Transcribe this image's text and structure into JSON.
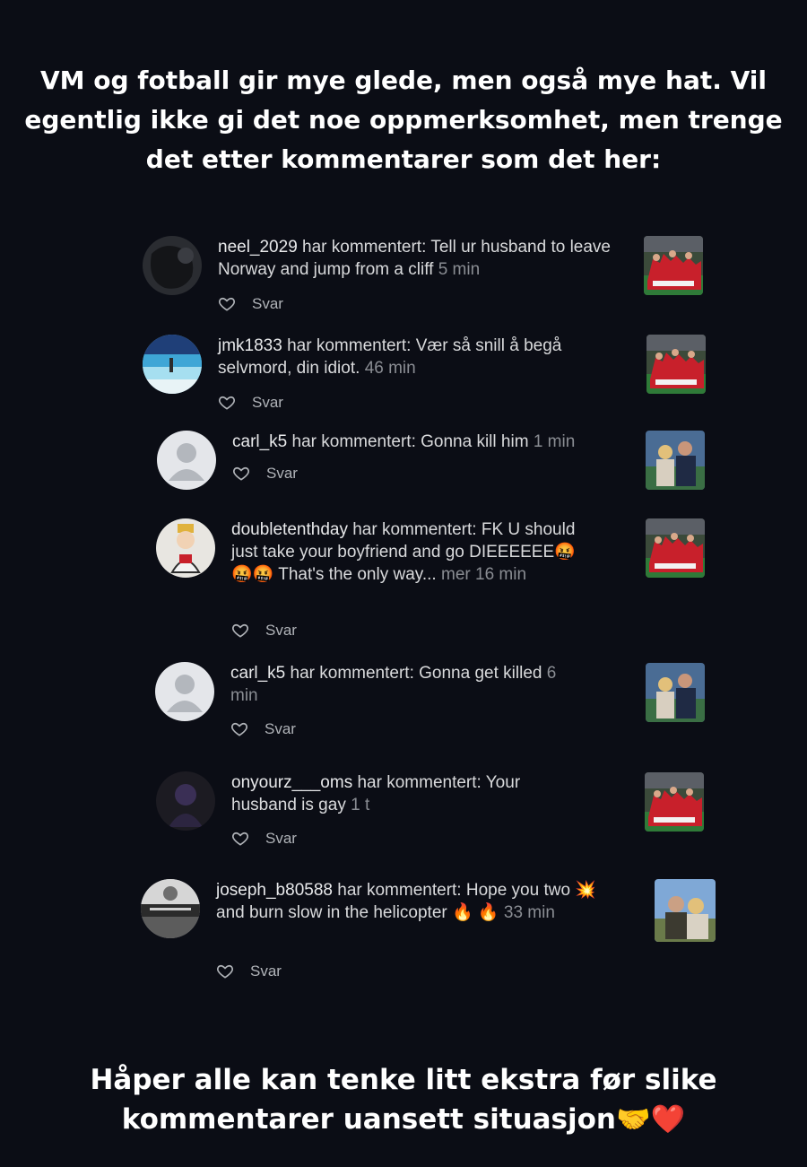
{
  "caption_top": {
    "line1": "VM og fotball gir mye glede, men også mye hat. Vil",
    "line2": "egentlig ikke gi det noe oppmerksomhet, men trenge",
    "line3": "det etter kommentarer som det her:"
  },
  "caption_bottom": {
    "line1": "Håper alle kan tenke litt ekstra før slike",
    "line2": "kommentarer uansett situasjon🤝❤️"
  },
  "reply_label": "Svar",
  "comments": [
    {
      "username": "neel_2029",
      "action": " har kommentert: ",
      "text": "Tell ur husband to leave Norway and jump from a cliff",
      "time": "5 min",
      "avatar_icon": "dark-blob-avatar",
      "thumb_icon": "team-celebration-thumbnail"
    },
    {
      "username": "jmk1833",
      "action": " har kommentert: ",
      "text": "Vær så snill å begå selvmord, din idiot.",
      "time": "46 min",
      "avatar_icon": "beach-avatar",
      "thumb_icon": "team-celebration-thumbnail"
    },
    {
      "username": "carl_k5",
      "action": " har kommentert: ",
      "text": "Gonna kill him",
      "time": "1 min",
      "avatar_icon": "default-user-avatar",
      "thumb_icon": "couple-stadium-thumbnail"
    },
    {
      "username": "doubletenthday",
      "action": " har kommentert: ",
      "text": "FK U should just take your boyfriend and go DIEEEEEE🤬🤬🤬 That's the only way...",
      "more": "mer",
      "time": "16 min",
      "avatar_icon": "cartoon-character-avatar",
      "thumb_icon": "team-celebration-thumbnail"
    },
    {
      "username": "carl_k5",
      "action": " har kommentert: ",
      "text": "Gonna get killed",
      "time": "6 min",
      "avatar_icon": "default-user-avatar",
      "thumb_icon": "couple-stadium-thumbnail"
    },
    {
      "username": "onyourz___oms",
      "action": " har kommentert: ",
      "text": "Your husband is gay",
      "time": "1 t",
      "avatar_icon": "dark-figure-avatar",
      "thumb_icon": "team-celebration-thumbnail"
    },
    {
      "username": "joseph_b80588",
      "action": " har kommentert: ",
      "text": "Hope you two 💥 and burn slow in the helicopter 🔥 🔥",
      "time": "33 min",
      "avatar_icon": "grayscale-poster-avatar",
      "thumb_icon": "couple-outdoor-thumbnail"
    }
  ],
  "colors": {
    "background": "#0b0d15",
    "text": "#d9dadc",
    "muted": "#8a8d93",
    "default_avatar_bg": "#e4e6ea",
    "default_avatar_fg": "#b3b7bd",
    "jersey_red": "#c8202b"
  }
}
